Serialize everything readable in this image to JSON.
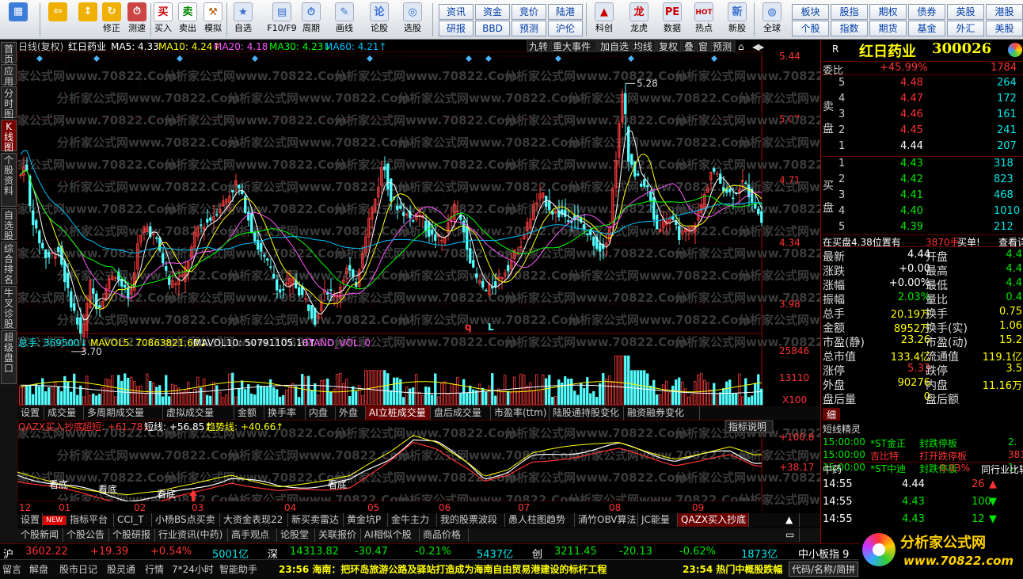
{
  "toolbar": {
    "buttons": [
      "买入",
      "卖出",
      "模拟",
      "自选",
      "F10/F9",
      "周期",
      "画线",
      "论股",
      "选股",
      "科创",
      "龙虎",
      "数据",
      "热点",
      "新股",
      "全球"
    ],
    "left_buttons": [
      "",
      "修正",
      "测速"
    ],
    "quick": [
      [
        "资讯",
        "资金",
        "竞价",
        "陆港"
      ],
      [
        "研报",
        "BBD",
        "预测",
        "沪伦"
      ]
    ],
    "right_quick": [
      [
        "板块",
        "股指",
        "期权",
        "债券",
        "英股",
        "港股"
      ],
      [
        "个股",
        "指数",
        "期货",
        "基金",
        "外汇",
        "美股"
      ]
    ]
  },
  "leftbar": [
    "首页",
    "应用",
    "分时图",
    "K线图",
    "个股资料",
    "自选股",
    "综合排名",
    "牛叉诊股",
    "超级盘口"
  ],
  "chart": {
    "title": "日线(复权)",
    "name": "红日药业",
    "ma": [
      {
        "label": "MA5: 4.33",
        "color": "#ffffff"
      },
      {
        "label": "MA10: 4.24↑",
        "color": "#ffff00"
      },
      {
        "label": "MA20: 4.18",
        "color": "#ff55ff"
      },
      {
        "label": "MA30: 4.23↓",
        "color": "#00ff00"
      },
      {
        "label": "MA60: 4.21↑",
        "color": "#00bfff"
      }
    ],
    "tools": [
      "九转",
      "重大事件",
      "加自选",
      "均线",
      "复权",
      "叠",
      "窗",
      "预测"
    ],
    "price_axis": [
      "5.44",
      "5.07",
      "4.71",
      "4.34",
      "3.98"
    ],
    "high_label": "5.28",
    "low_label": "3.70",
    "marks": [
      "q",
      "L"
    ],
    "vol_title": "总手: 369500↓",
    "vol_ma5": "MAVOL5: 70863821.60↓",
    "vol_ma10": "MAVOL10: 50791105.10↑",
    "stand": "STAND_VOL: 0",
    "vol_axis": [
      "25846",
      "13110",
      "X100"
    ],
    "ind_title": "QAZX买入抄底",
    "ind_vals": [
      "超短: +61.78↓",
      "短线: +56.85↑",
      "趋势线: +40.66↑"
    ],
    "ind_axis": [
      "+100.8",
      "+38.17"
    ],
    "ind_btn": "指标说明",
    "ind_marks": [
      "看底",
      "看底",
      "看底",
      "看底"
    ],
    "months": [
      "12",
      "01",
      "02",
      "03",
      "04",
      "05",
      "06",
      "07",
      "08",
      "09"
    ],
    "watermark": "分析家公式网www.70822.Com"
  },
  "tabs1": [
    "设置",
    "成交量",
    "多周期成交量",
    "虚拟成交量",
    "金额",
    "换手率",
    "内盘",
    "外盘",
    "AI立桩成交量",
    "盘后成交量",
    "市盈率(ttm)",
    "陆股通持股变化",
    "融资融券变化"
  ],
  "tabs2": [
    "设置",
    "NEW",
    "指标平台",
    "CCI_T",
    "小杨BS点买卖",
    "大资金表现22",
    "新买卖雷达",
    "黄金坑P",
    "金牛主力",
    "我的股票波段",
    "愚人柱图趋势",
    "涌竹OBV算法",
    "JC能量",
    "QAZX买入抄底"
  ],
  "tabs3": [
    "个股新闻",
    "个股公告",
    "个股研报",
    "行业资讯(中药)",
    "高手观点",
    "论股堂",
    "关联报价",
    "AI相似个股",
    "商品价格"
  ],
  "quote": {
    "flag": "R",
    "name": "红日药业",
    "code": "300026",
    "weibi_label": "委比",
    "weibi": "+45.99%",
    "weibi_v": "1784",
    "sell": [
      [
        "5",
        "4.48",
        "264"
      ],
      [
        "4",
        "4.47",
        "172"
      ],
      [
        "3",
        "4.46",
        "161"
      ],
      [
        "2",
        "4.45",
        "241"
      ],
      [
        "1",
        "4.44",
        "207"
      ]
    ],
    "buy": [
      [
        "1",
        "4.43",
        "318"
      ],
      [
        "2",
        "4.42",
        "823"
      ],
      [
        "3",
        "4.41",
        "468"
      ],
      [
        "4",
        "4.40",
        "1010"
      ],
      [
        "5",
        "4.39",
        "212"
      ]
    ],
    "sell_label": "卖盘",
    "buy_label": "买盘",
    "notice": "在买盘4.38位置有",
    "notice_v": "3870手",
    "notice_b": "买单!",
    "notice_c": "查看详情",
    "stats": [
      [
        "最新",
        "4.44",
        "开盘",
        "4.4"
      ],
      [
        "涨跌",
        "+0.00",
        "最高",
        "4.4"
      ],
      [
        "涨幅",
        "+0.00%",
        "最低",
        "4.4"
      ],
      [
        "振幅",
        "2.03%",
        "量比",
        "0.4"
      ],
      [
        "总手",
        "20.19万",
        "换手",
        "0.75"
      ],
      [
        "金额",
        "8952万",
        "换手(实)",
        "1.06"
      ],
      [
        "市盈(静)",
        "23.26",
        "市盈(动)",
        "15.2"
      ],
      [
        "总市值",
        "133.4亿",
        "流通值",
        "119.1亿"
      ],
      [
        "涨停",
        "5.33",
        "跌停",
        "3.5"
      ],
      [
        "外盘",
        "90276",
        "内盘",
        "11.16万"
      ],
      [
        "盘后量",
        "0",
        "盘后额",
        ""
      ]
    ],
    "tab_detail": "细",
    "tab_short": "短线精灵",
    "short": [
      [
        "15:00:00",
        "*ST金正",
        "封跌停板",
        "2."
      ],
      [
        "15:00:00",
        "吉比特",
        "打开跌停板",
        "381."
      ],
      [
        "15:00:00",
        "*ST中迪",
        "封跌停板",
        "1."
      ]
    ],
    "sector": "中药",
    "sector_pct": "0.03%",
    "sector_cmp": "同行业比较",
    "ticks": [
      [
        "14:55",
        "4.44",
        "26",
        "up"
      ],
      [
        "14:55",
        "4.43",
        "100",
        "down"
      ],
      [
        "14:55",
        "4.43",
        "12",
        "down"
      ]
    ]
  },
  "index": [
    {
      "n": "沪",
      "v": "3602.22",
      "c": "+19.39",
      "p": "+0.54%",
      "a": "5001亿"
    },
    {
      "n": "深",
      "v": "14313.82",
      "c": "-30.47",
      "p": "-0.21%",
      "a": "5437亿"
    },
    {
      "n": "创",
      "v": "3211.45",
      "c": "-20.13",
      "p": "-0.62%",
      "a": "1873亿"
    }
  ],
  "index_extra": "中小板指 9",
  "status": {
    "items": [
      "留言",
      "解盘",
      "股市日记",
      "股灵通",
      "行情",
      "7*24小时",
      "智能助手"
    ],
    "news1": "23:56 海南：把环岛旅游公路及驿站打造成为海南自由贸易港建设的标杆工程",
    "news2": "23:54 热门中概股跌幅",
    "input": "代码/名称/简拼"
  },
  "logo": {
    "text": "分析家公式网",
    "url": "www.70822.com"
  }
}
